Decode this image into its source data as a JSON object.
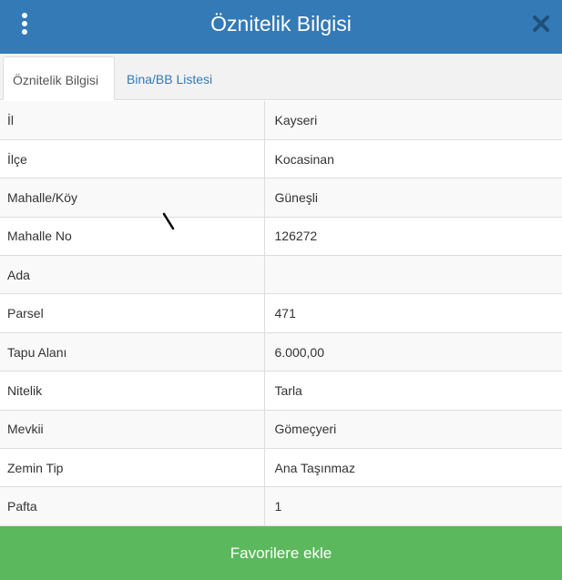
{
  "header": {
    "title": "Öznitelik Bilgisi",
    "menu_icon": "kebab-menu-icon",
    "close_icon": "close-icon"
  },
  "tabs": [
    {
      "label": "Öznitelik Bilgisi",
      "active": true
    },
    {
      "label": "Bina/BB Listesi",
      "active": false
    }
  ],
  "attributes": [
    {
      "key": "İl",
      "value": "Kayseri"
    },
    {
      "key": "İlçe",
      "value": "Kocasinan"
    },
    {
      "key": "Mahalle/Köy",
      "value": "Güneşli"
    },
    {
      "key": "Mahalle No",
      "value": "126272"
    },
    {
      "key": "Ada",
      "value": ""
    },
    {
      "key": "Parsel",
      "value": "471"
    },
    {
      "key": "Tapu Alanı",
      "value": "6.000,00"
    },
    {
      "key": "Nitelik",
      "value": "Tarla"
    },
    {
      "key": "Mevkii",
      "value": "Gömeçyeri"
    },
    {
      "key": "Zemin Tip",
      "value": "Ana Taşınmaz"
    },
    {
      "key": "Pafta",
      "value": "1"
    }
  ],
  "footer": {
    "button_label": "Favorilere ekle"
  },
  "colors": {
    "header": "#337ab7",
    "footer": "#5cb85c",
    "link": "#337ab7"
  }
}
